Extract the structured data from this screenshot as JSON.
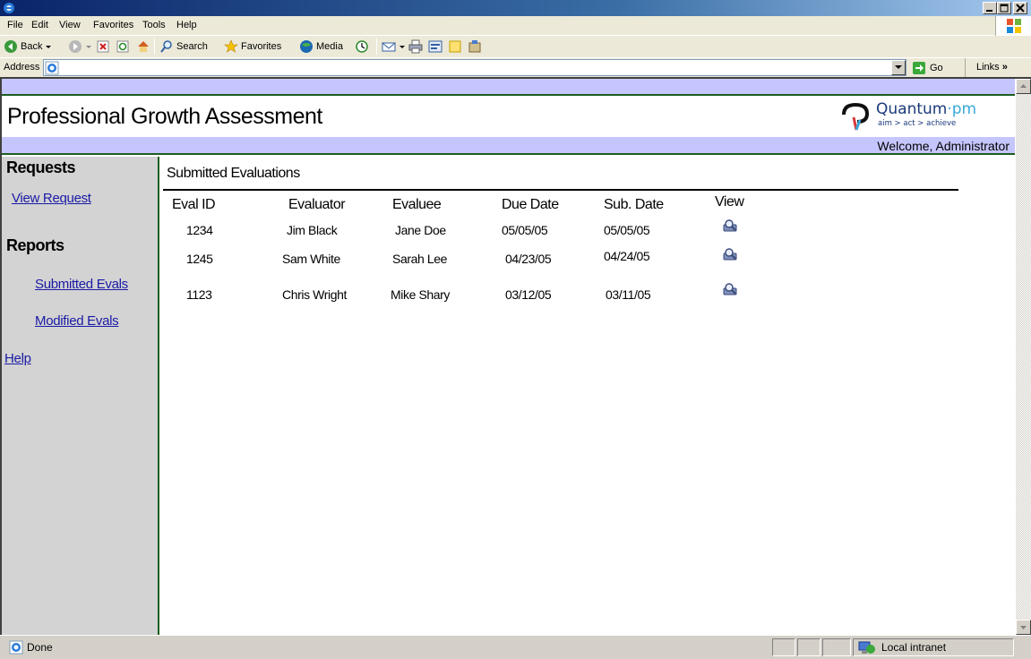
{
  "menubar": {
    "items": [
      "File",
      "Edit",
      "View",
      "Favorites",
      "Tools",
      "Help"
    ]
  },
  "toolbar": {
    "back_label": "Back",
    "search_label": "Search",
    "favorites_label": "Favorites",
    "media_label": "Media"
  },
  "addressbar": {
    "label": "Address",
    "value": "",
    "go_label": "Go",
    "links_label": "Links"
  },
  "page": {
    "app_title": "Professional Growth Assessment",
    "logo": {
      "name": "Quantum",
      "sep": "·",
      "suffix": "pm",
      "tagline": "aim > act > achieve"
    },
    "welcome": "Welcome, Administrator",
    "sidebar": {
      "requests_heading": "Requests",
      "view_request": "View Request",
      "reports_heading": "Reports",
      "submitted_evals": "Submitted Evals",
      "modified_evals": "Modified Evals",
      "help": "Help"
    },
    "section_title": "Submitted Evaluations",
    "table": {
      "headers": [
        "Eval ID",
        "Evaluator",
        "Evaluee",
        "Due Date",
        "Sub. Date",
        "View"
      ],
      "rows": [
        [
          "1234",
          "Jim Black",
          "Jane Doe",
          "05/05/05",
          "05/05/05"
        ],
        [
          "1245",
          "Sam White",
          "Sarah Lee",
          "04/23/05",
          "04/24/05"
        ],
        [
          "1123",
          "Chris Wright",
          "Mike Shary",
          "03/12/05",
          "03/11/05"
        ]
      ]
    }
  },
  "statusbar": {
    "status": "Done",
    "zone": "Local intranet"
  },
  "colors": {
    "strip": "#c6c6ff",
    "divider": "#1b5e20",
    "sidebar_bg": "#d3d3d3",
    "link": "#1a1aa6"
  }
}
